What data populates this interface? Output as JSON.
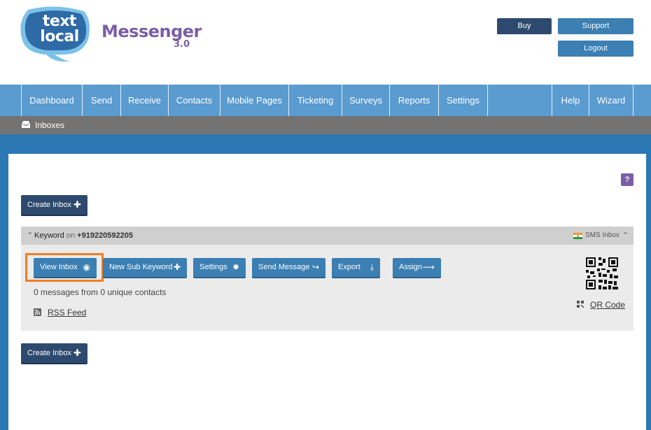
{
  "logo": {
    "line1": "text",
    "line2": "local"
  },
  "app": {
    "name": "Messenger",
    "version": "3.0"
  },
  "header_buttons": {
    "buy": "Buy",
    "support": "Support",
    "logout": "Logout"
  },
  "nav": {
    "items": [
      "Dashboard",
      "Send",
      "Receive",
      "Contacts",
      "Mobile Pages",
      "Ticketing",
      "Surveys",
      "Reports",
      "Settings"
    ],
    "right_items": [
      "Help",
      "Wizard"
    ]
  },
  "subbar": {
    "label": "Inboxes",
    "icon": "inbox-icon"
  },
  "help_badge": "?",
  "create_inbox_label": "Create Inbox",
  "inbox": {
    "keyword": "Keyword",
    "on_text": "on",
    "number": "+919220592205",
    "type": "SMS Inbox",
    "actions": {
      "view": "View Inbox",
      "sub_keyword": "New Sub Keyword",
      "settings": "Settings",
      "send_message": "Send Message",
      "export": "Export",
      "assign": "Assign"
    },
    "message_summary": "0 messages from 0 unique contacts",
    "rss": "RSS Feed",
    "qr": "QR Code"
  },
  "colors": {
    "nav": "#5a9bd0",
    "dark_button": "#2d4a6e",
    "action_button": "#3b7fb3",
    "brand_purple": "#7b5ea7",
    "highlight": "#f07e23"
  }
}
